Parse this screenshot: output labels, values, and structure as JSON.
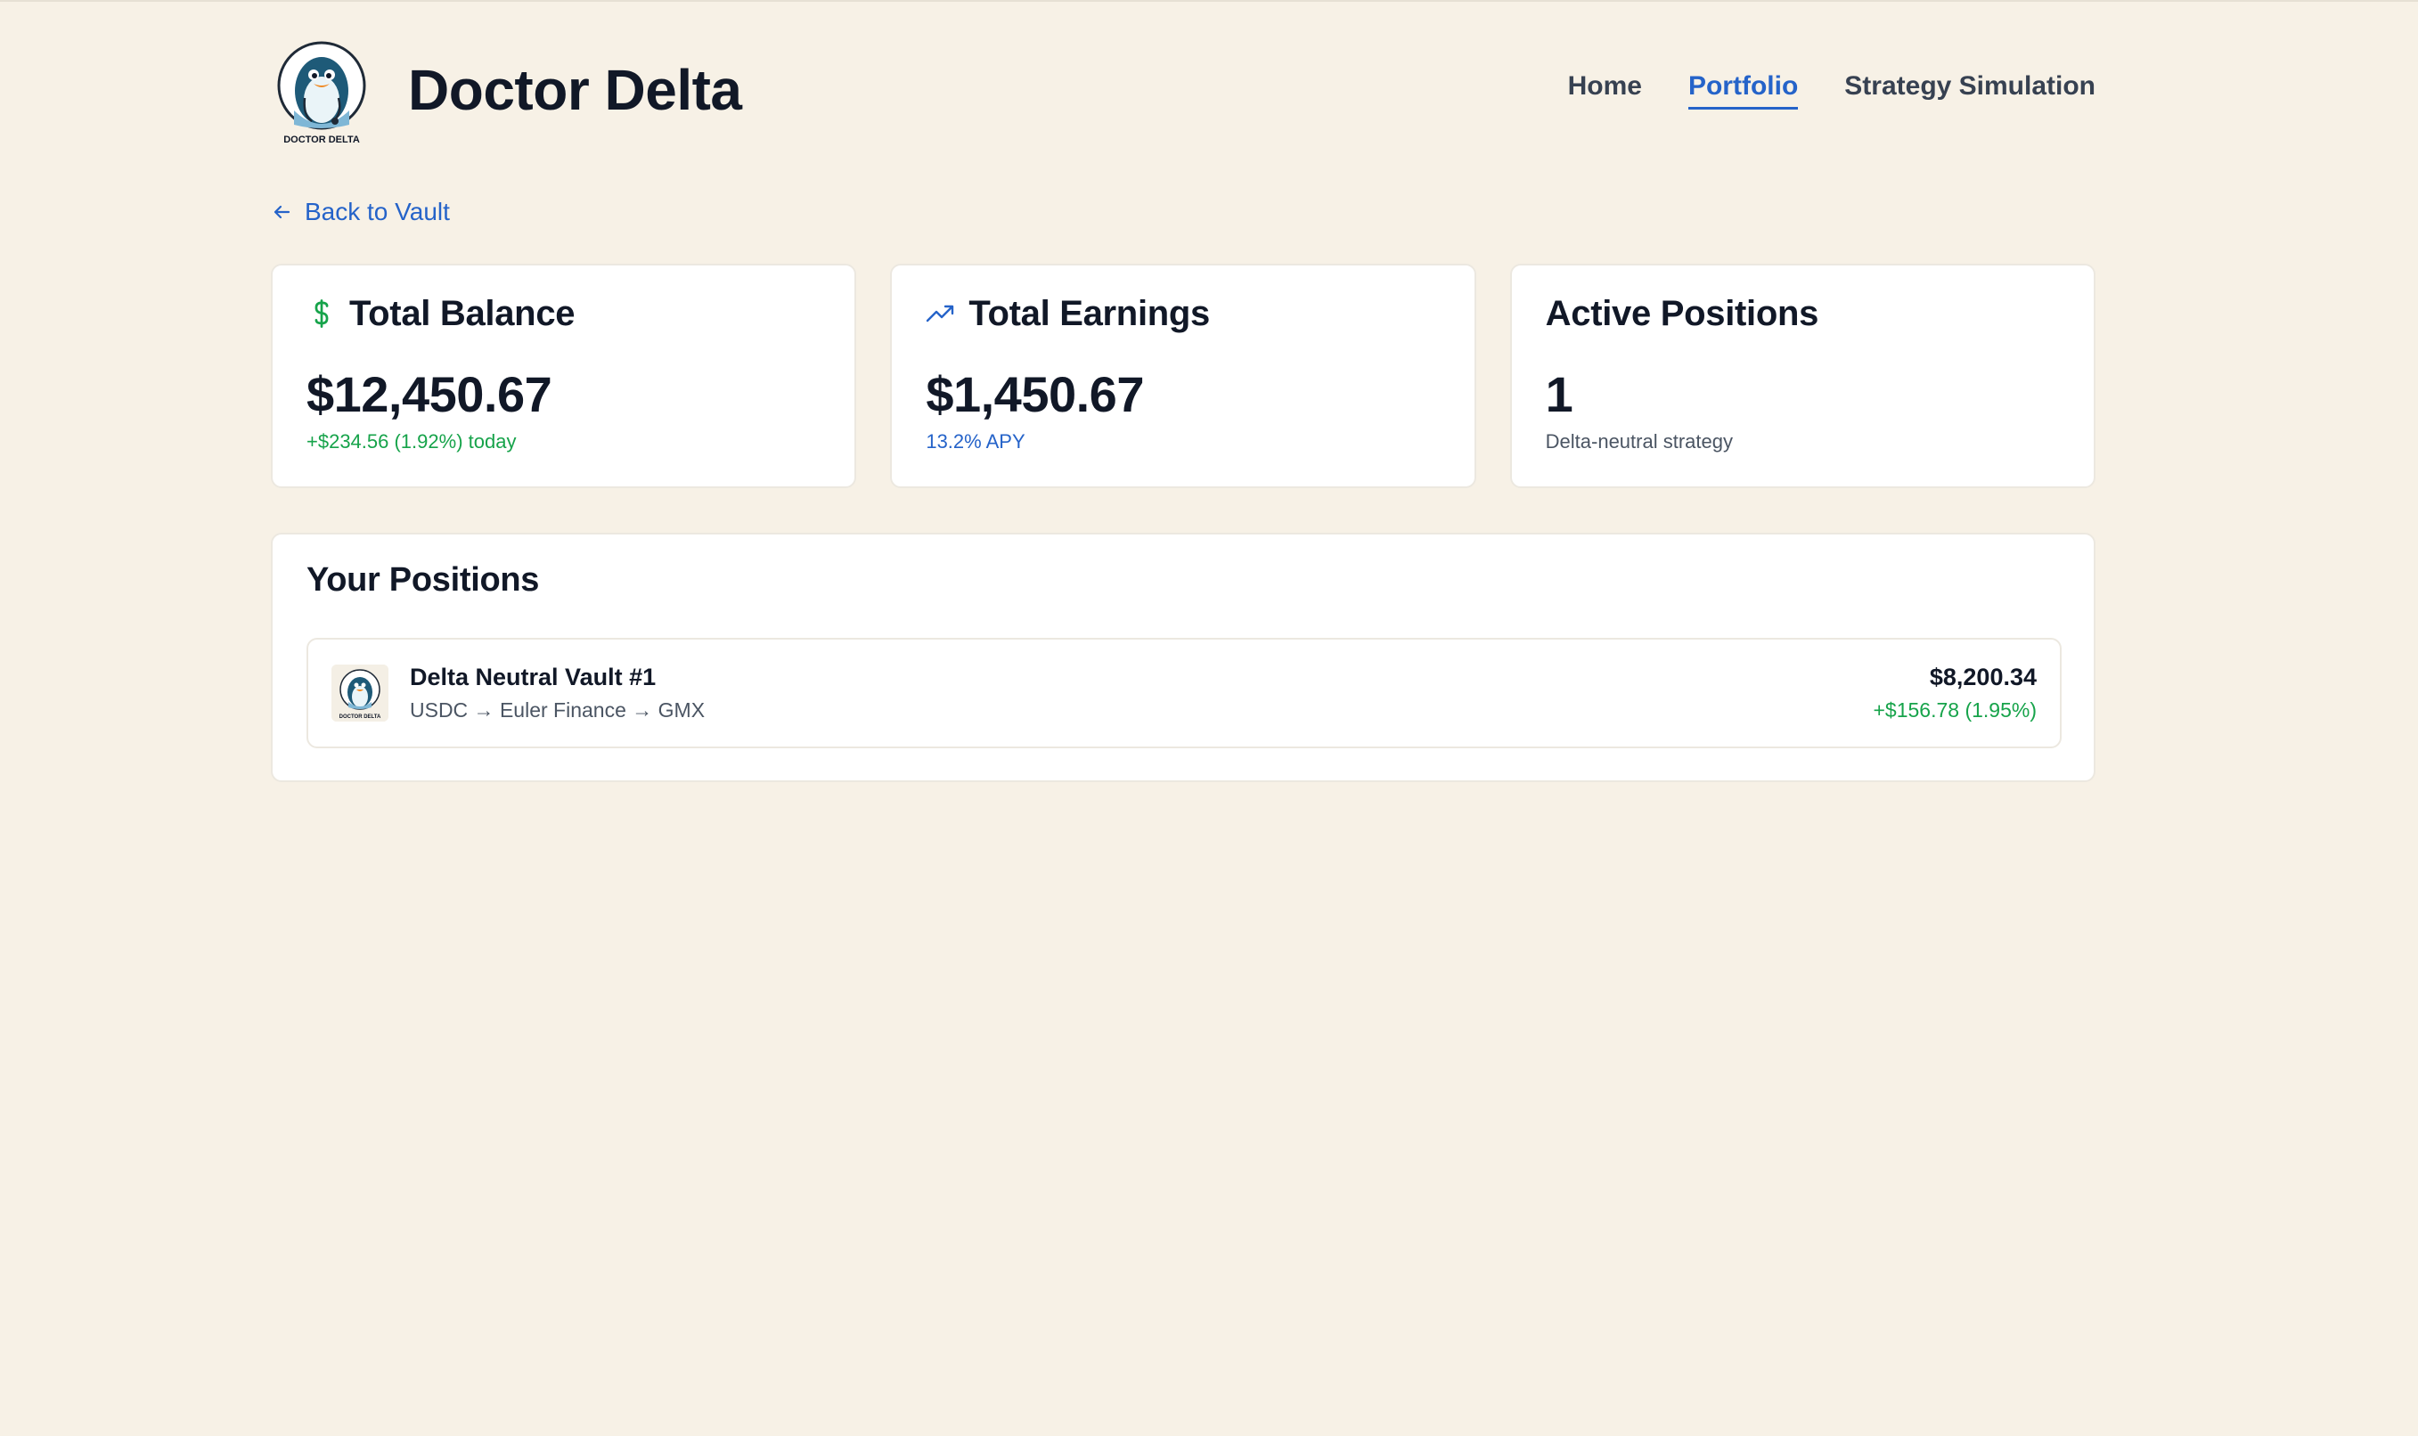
{
  "brand": {
    "title": "Doctor Delta",
    "logo_text": "DOCTOR DELTA"
  },
  "nav": {
    "items": [
      {
        "label": "Home",
        "active": false
      },
      {
        "label": "Portfolio",
        "active": true
      },
      {
        "label": "Strategy Simulation",
        "active": false
      }
    ]
  },
  "back_link": {
    "label": "Back to Vault",
    "icon": "arrow-left-icon"
  },
  "cards": [
    {
      "title": "Total Balance",
      "icon": "dollar-icon",
      "value": "$12,450.67",
      "sub": "+$234.56 (1.92%) today",
      "sub_color": "#16a34a"
    },
    {
      "title": "Total Earnings",
      "icon": "trending-up-icon",
      "value": "$1,450.67",
      "sub": "13.2% APY",
      "sub_color": "#2563c9"
    },
    {
      "title": "Active Positions",
      "icon": "",
      "value": "1",
      "sub": "Delta-neutral strategy",
      "sub_color": "#4b5563"
    }
  ],
  "positions": {
    "title": "Your Positions",
    "items": [
      {
        "name": "Delta Neutral Vault #1",
        "route": "USDC → Euler Finance → GMX",
        "value": "$8,200.34",
        "change": "+$156.78 (1.95%)"
      }
    ]
  },
  "colors": {
    "background": "#f7f1e6",
    "accent": "#2563c9",
    "positive": "#16a34a"
  }
}
